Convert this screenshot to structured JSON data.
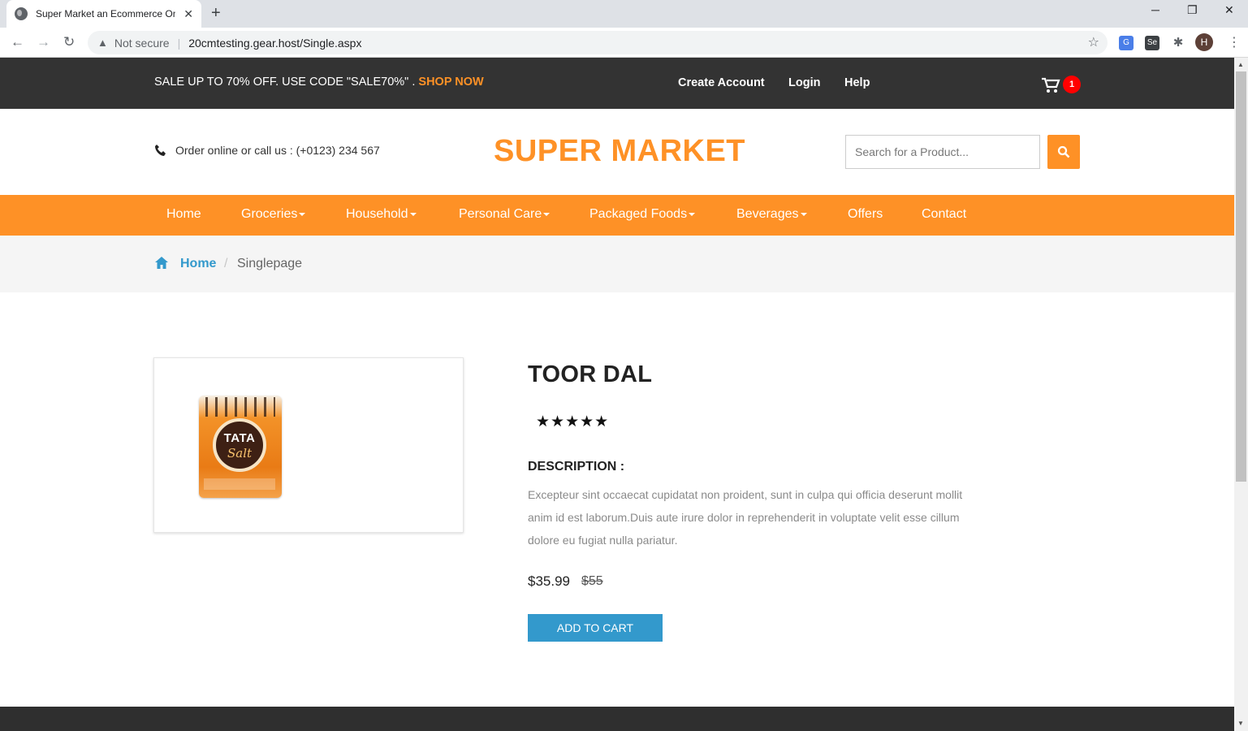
{
  "browser": {
    "tab_title": "Super Market an Ecommerce Onl",
    "not_secure": "Not secure",
    "url": "20cmtesting.gear.host/Single.aspx",
    "profile_initial": "H"
  },
  "topbar": {
    "promo_text": "SALE UP TO 70% OFF. USE CODE \"SALE70%\" . ",
    "promo_link": "SHOP NOW",
    "links": [
      "Create Account",
      "Login",
      "Help"
    ],
    "cart_count": "1"
  },
  "header": {
    "phone_text": "Order online or call us : (+0123) 234 567",
    "logo": "SUPER MARKET",
    "search_placeholder": "Search for a Product..."
  },
  "nav": {
    "items": [
      {
        "label": "Home"
      },
      {
        "label": "Groceries"
      },
      {
        "label": "Household"
      },
      {
        "label": "Personal Care"
      },
      {
        "label": "Packaged Foods"
      },
      {
        "label": "Beverages"
      },
      {
        "label": "Offers"
      },
      {
        "label": "Contact"
      }
    ]
  },
  "breadcrumb": {
    "home": "Home",
    "separator": "/",
    "current": "Singlepage"
  },
  "product": {
    "name": "TOOR DAL",
    "rating": 5,
    "stars": "★★★★★",
    "image_brand": "TATA",
    "image_product": "Salt",
    "description_label": "DESCRIPTION :",
    "description": "Excepteur sint occaecat cupidatat non proident, sunt in culpa qui officia deserunt mollit anim id est laborum.Duis aute irure dolor in reprehenderit in voluptate velit esse cillum dolore eu fugiat nulla pariatur.",
    "price": "$35.99",
    "old_price": "$55",
    "add_to_cart_label": "ADD TO CART"
  },
  "colors": {
    "accent": "#fe9126",
    "topbar": "#333333",
    "link_blue": "#3399cc",
    "badge": "#ff0000"
  }
}
